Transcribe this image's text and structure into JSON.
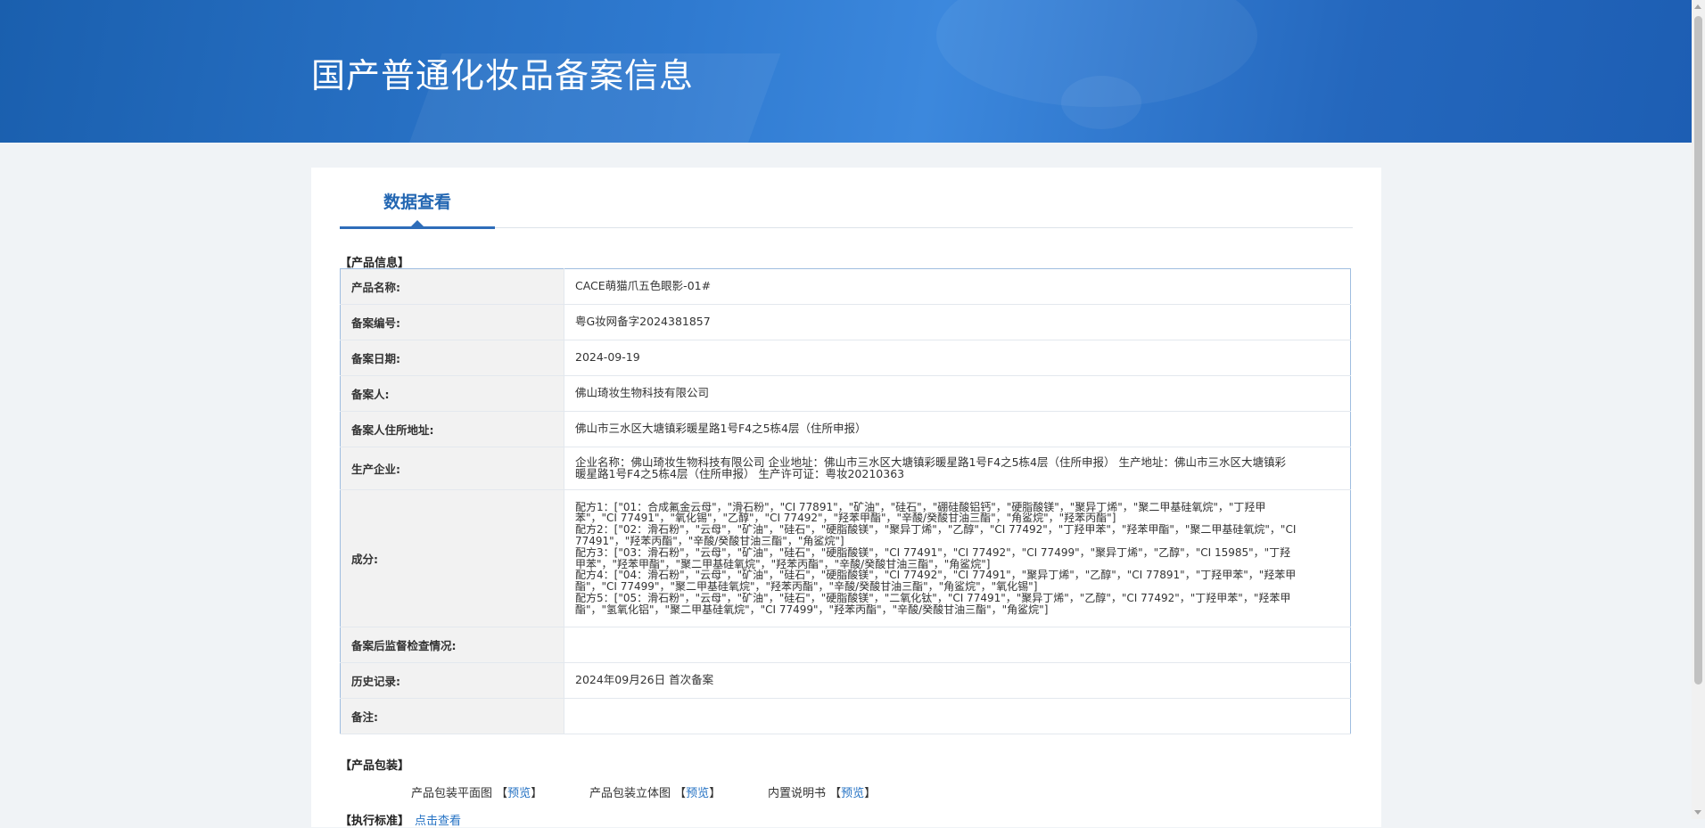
{
  "page": {
    "title": "国产普通化妆品备案信息"
  },
  "tab": {
    "label": "数据查看"
  },
  "product_info": {
    "section_title": "【产品信息】",
    "rows": [
      {
        "label": "产品名称:",
        "value": "CACE萌猫爪五色眼影-01#"
      },
      {
        "label": "备案编号:",
        "value": "粤G妆网备字2024381857"
      },
      {
        "label": "备案日期:",
        "value": "2024-09-19"
      },
      {
        "label": "备案人:",
        "value": "佛山琦妆生物科技有限公司"
      },
      {
        "label": "备案人住所地址:",
        "value": "佛山市三水区大塘镇彩暖星路1号F4之5栋4层（住所申报）"
      },
      {
        "label": "生产企业:",
        "value": "企业名称：佛山琦妆生物科技有限公司 企业地址：佛山市三水区大塘镇彩暖星路1号F4之5栋4层（住所申报） 生产地址：佛山市三水区大塘镇彩暖星路1号F4之5栋4层（住所申报） 生产许可证：粤妆20210363"
      },
      {
        "label": "成分:",
        "lines": [
          "配方1：[\"01：合成氟金云母\"，\"滑石粉\"，\"CI 77891\"，\"矿油\"，\"硅石\"，\"硼硅酸铝钙\"，\"硬脂酸镁\"，\"聚异丁烯\"，\"聚二甲基硅氧烷\"，\"丁羟甲苯\"，\"CI 77491\"，\"氧化锡\"，\"乙醇\"，\"CI 77492\"，\"羟苯甲酯\"，\"辛酸/癸酸甘油三酯\"，\"角鲨烷\"，\"羟苯丙酯\"]",
          "配方2：[\"02：滑石粉\"，\"云母\"，\"矿油\"，\"硅石\"，\"硬脂酸镁\"，\"聚异丁烯\"，\"乙醇\"，\"CI 77492\"，\"丁羟甲苯\"，\"羟苯甲酯\"，\"聚二甲基硅氧烷\"，\"CI 77491\"，\"羟苯丙酯\"，\"辛酸/癸酸甘油三酯\"，\"角鲨烷\"]",
          "配方3：[\"03：滑石粉\"，\"云母\"，\"矿油\"，\"硅石\"，\"硬脂酸镁\"，\"CI 77491\"，\"CI 77492\"，\"CI 77499\"，\"聚异丁烯\"，\"乙醇\"，\"CI 15985\"，\"丁羟甲苯\"，\"羟苯甲酯\"，\"聚二甲基硅氧烷\"，\"羟苯丙酯\"，\"辛酸/癸酸甘油三酯\"，\"角鲨烷\"]",
          "配方4：[\"04：滑石粉\"，\"云母\"，\"矿油\"，\"硅石\"，\"硬脂酸镁\"，\"CI 77492\"，\"CI 77491\"，\"聚异丁烯\"，\"乙醇\"，\"CI 77891\"，\"丁羟甲苯\"，\"羟苯甲酯\"，\"CI 77499\"，\"聚二甲基硅氧烷\"，\"羟苯丙酯\"，\"辛酸/癸酸甘油三酯\"，\"角鲨烷\"，\"氧化锡\"]",
          "配方5：[\"05：滑石粉\"，\"云母\"，\"矿油\"，\"硅石\"，\"硬脂酸镁\"，\"二氧化钛\"，\"CI 77491\"，\"聚异丁烯\"，\"乙醇\"，\"CI 77492\"，\"丁羟甲苯\"，\"羟苯甲酯\"，\"氢氧化铝\"，\"聚二甲基硅氧烷\"，\"CI 77499\"，\"羟苯丙酯\"，\"辛酸/癸酸甘油三酯\"，\"角鲨烷\"]"
        ]
      },
      {
        "label": "备案后监督检查情况:",
        "value": ""
      },
      {
        "label": "历史记录:",
        "value": "2024年09月26日 首次备案"
      },
      {
        "label": "备注:",
        "value": ""
      }
    ]
  },
  "packaging": {
    "section_title": "【产品包装】",
    "items": [
      {
        "label": "产品包装平面图",
        "open": "【",
        "link": "预览",
        "close": "】"
      },
      {
        "label": "产品包装立体图",
        "open": "【",
        "link": "预览",
        "close": "】"
      },
      {
        "label": "内置说明书",
        "open": "【",
        "link": "预览",
        "close": "】"
      }
    ]
  },
  "exec_standard": {
    "label": "【执行标准】",
    "link": "点击查看"
  },
  "colors": {
    "banner": "#2467bd",
    "accent": "#2266b2",
    "link": "#2673c4"
  }
}
